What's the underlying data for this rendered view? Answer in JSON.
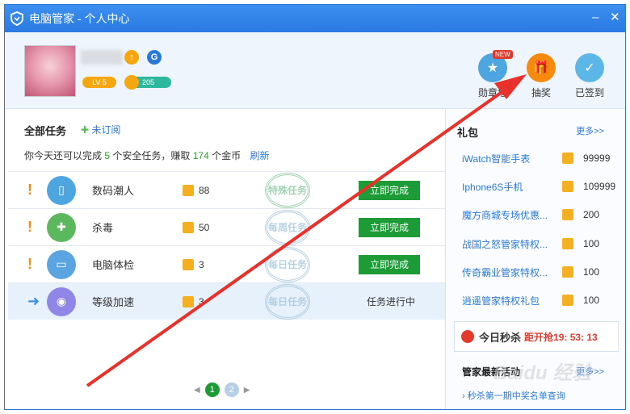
{
  "window": {
    "title": "电脑管家 - 个人中心"
  },
  "profile": {
    "level": "LV 5",
    "coins": "205"
  },
  "header_buttons": [
    {
      "label": "勋章墙",
      "tag": "NEW",
      "color": "#4da6e0"
    },
    {
      "label": "抽奖",
      "color": "#f58a0f"
    },
    {
      "label": "已签到",
      "color": "#5db6e8"
    }
  ],
  "tasks": {
    "title": "全部任务",
    "unsubscribed": "未订阅",
    "summary_prefix": "你今天还可以完成",
    "summary_count": "5",
    "summary_mid": "个安全任务，赚取",
    "summary_coins": "174",
    "summary_suffix": "个金币",
    "refresh": "刷新",
    "items": [
      {
        "name": "数码潮人",
        "coins": "88",
        "stamp": "特殊任务",
        "action": "立即完成",
        "mark": "!",
        "icon_color": "#4da6e0"
      },
      {
        "name": "杀毒",
        "coins": "50",
        "stamp": "每周任务",
        "action": "立即完成",
        "mark": "!",
        "icon_color": "#5cb85c"
      },
      {
        "name": "电脑体检",
        "coins": "3",
        "stamp": "每日任务",
        "action": "立即完成",
        "mark": "!",
        "icon_color": "#5aa4e2"
      },
      {
        "name": "等级加速",
        "coins": "3",
        "stamp": "每日任务",
        "status": "任务进行中",
        "mark": "➜",
        "icon_color": "#8f86e8"
      }
    ],
    "pages": [
      "1",
      "2"
    ]
  },
  "gifts": {
    "title": "礼包",
    "more": "更多>>",
    "items": [
      {
        "name": "iWatch智能手表",
        "coins": "99999"
      },
      {
        "name": "Iphone6S手机",
        "coins": "109999"
      },
      {
        "name": "魔方商城专场优惠...",
        "coins": "200"
      },
      {
        "name": "战国之怒管家特权...",
        "coins": "100"
      },
      {
        "name": "传奇霸业管家特权...",
        "coins": "100"
      },
      {
        "name": "逍遥管家特权礼包",
        "coins": "100"
      }
    ]
  },
  "flash_sale": {
    "title": "今日秒杀",
    "countdown": "距开抢19: 53: 13"
  },
  "news": {
    "title": "管家最新活动",
    "more": "更多>>",
    "item": "› 秒杀第一期中奖名单查询"
  },
  "watermark": "Baidu 经验"
}
